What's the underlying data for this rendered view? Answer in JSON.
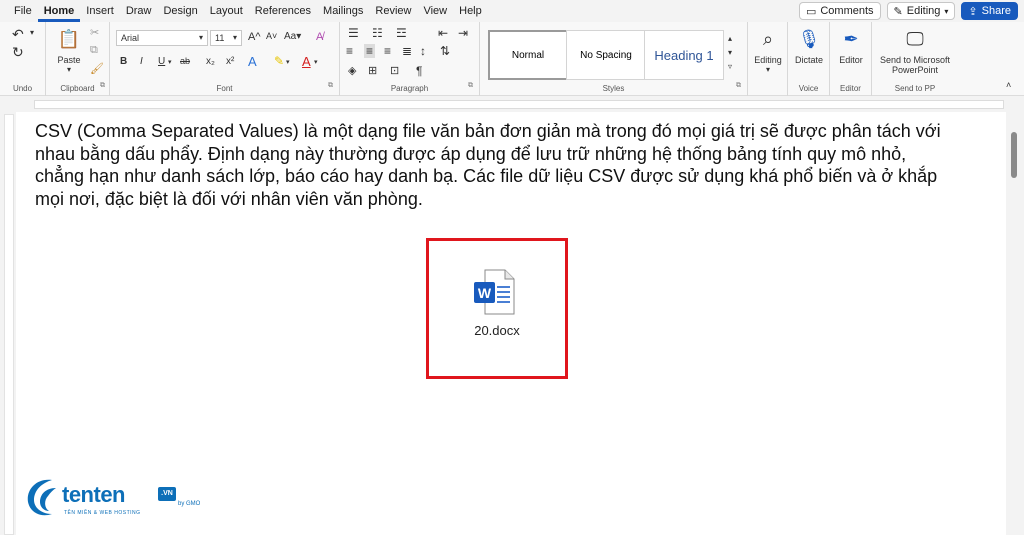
{
  "menu": {
    "items": [
      "File",
      "Home",
      "Insert",
      "Draw",
      "Design",
      "Layout",
      "References",
      "Mailings",
      "Review",
      "View",
      "Help"
    ],
    "comments": "Comments",
    "editing": "Editing",
    "share": "Share"
  },
  "ribbon": {
    "undo_label": "Undo",
    "clipboard": {
      "paste": "Paste",
      "label": "Clipboard"
    },
    "font": {
      "name": "Arial",
      "size": "11",
      "label": "Font",
      "bold": "B",
      "italic": "I",
      "underline": "U",
      "strike": "ab",
      "subscript": "x₂",
      "superscript": "x²",
      "grow": "A",
      "change_case": "Aa"
    },
    "paragraph": {
      "label": "Paragraph"
    },
    "styles": {
      "normal": "Normal",
      "no_spacing": "No Spacing",
      "heading1": "Heading 1",
      "label": "Styles"
    },
    "editing": {
      "label": "Editing"
    },
    "voice": {
      "dictate": "Dictate",
      "label": "Voice"
    },
    "editor": {
      "editor": "Editor",
      "label": "Editor"
    },
    "send": {
      "line1": "Send to Microsoft",
      "line2": "PowerPoint",
      "label": "Send to PP"
    }
  },
  "colors": {
    "accent": "#185abd",
    "highlight_border": "#e0161d",
    "logo_blue": "#0d6fb8"
  },
  "document": {
    "paragraph": "CSV (Comma Separated Values) là một dạng file văn bản đơn giản mà trong đó mọi giá trị sẽ được phân tách với nhau bằng dấu phẩy. Định dạng này thường được áp dụng để lưu trữ những hệ thống bảng tính quy mô nhỏ, chẳng hạn như danh sách lớp, báo cáo hay danh bạ. Các file dữ liệu CSV được sử dụng khá phổ biến và ở khắp mọi nơi, đặc biệt là đối với nhân viên văn phòng.",
    "attachment_name": "20.docx"
  },
  "logo": {
    "brand": "tenten",
    "tld": ".VN",
    "by": "by GMO",
    "tagline": "TÊN MIỀN & WEB HOSTING"
  }
}
